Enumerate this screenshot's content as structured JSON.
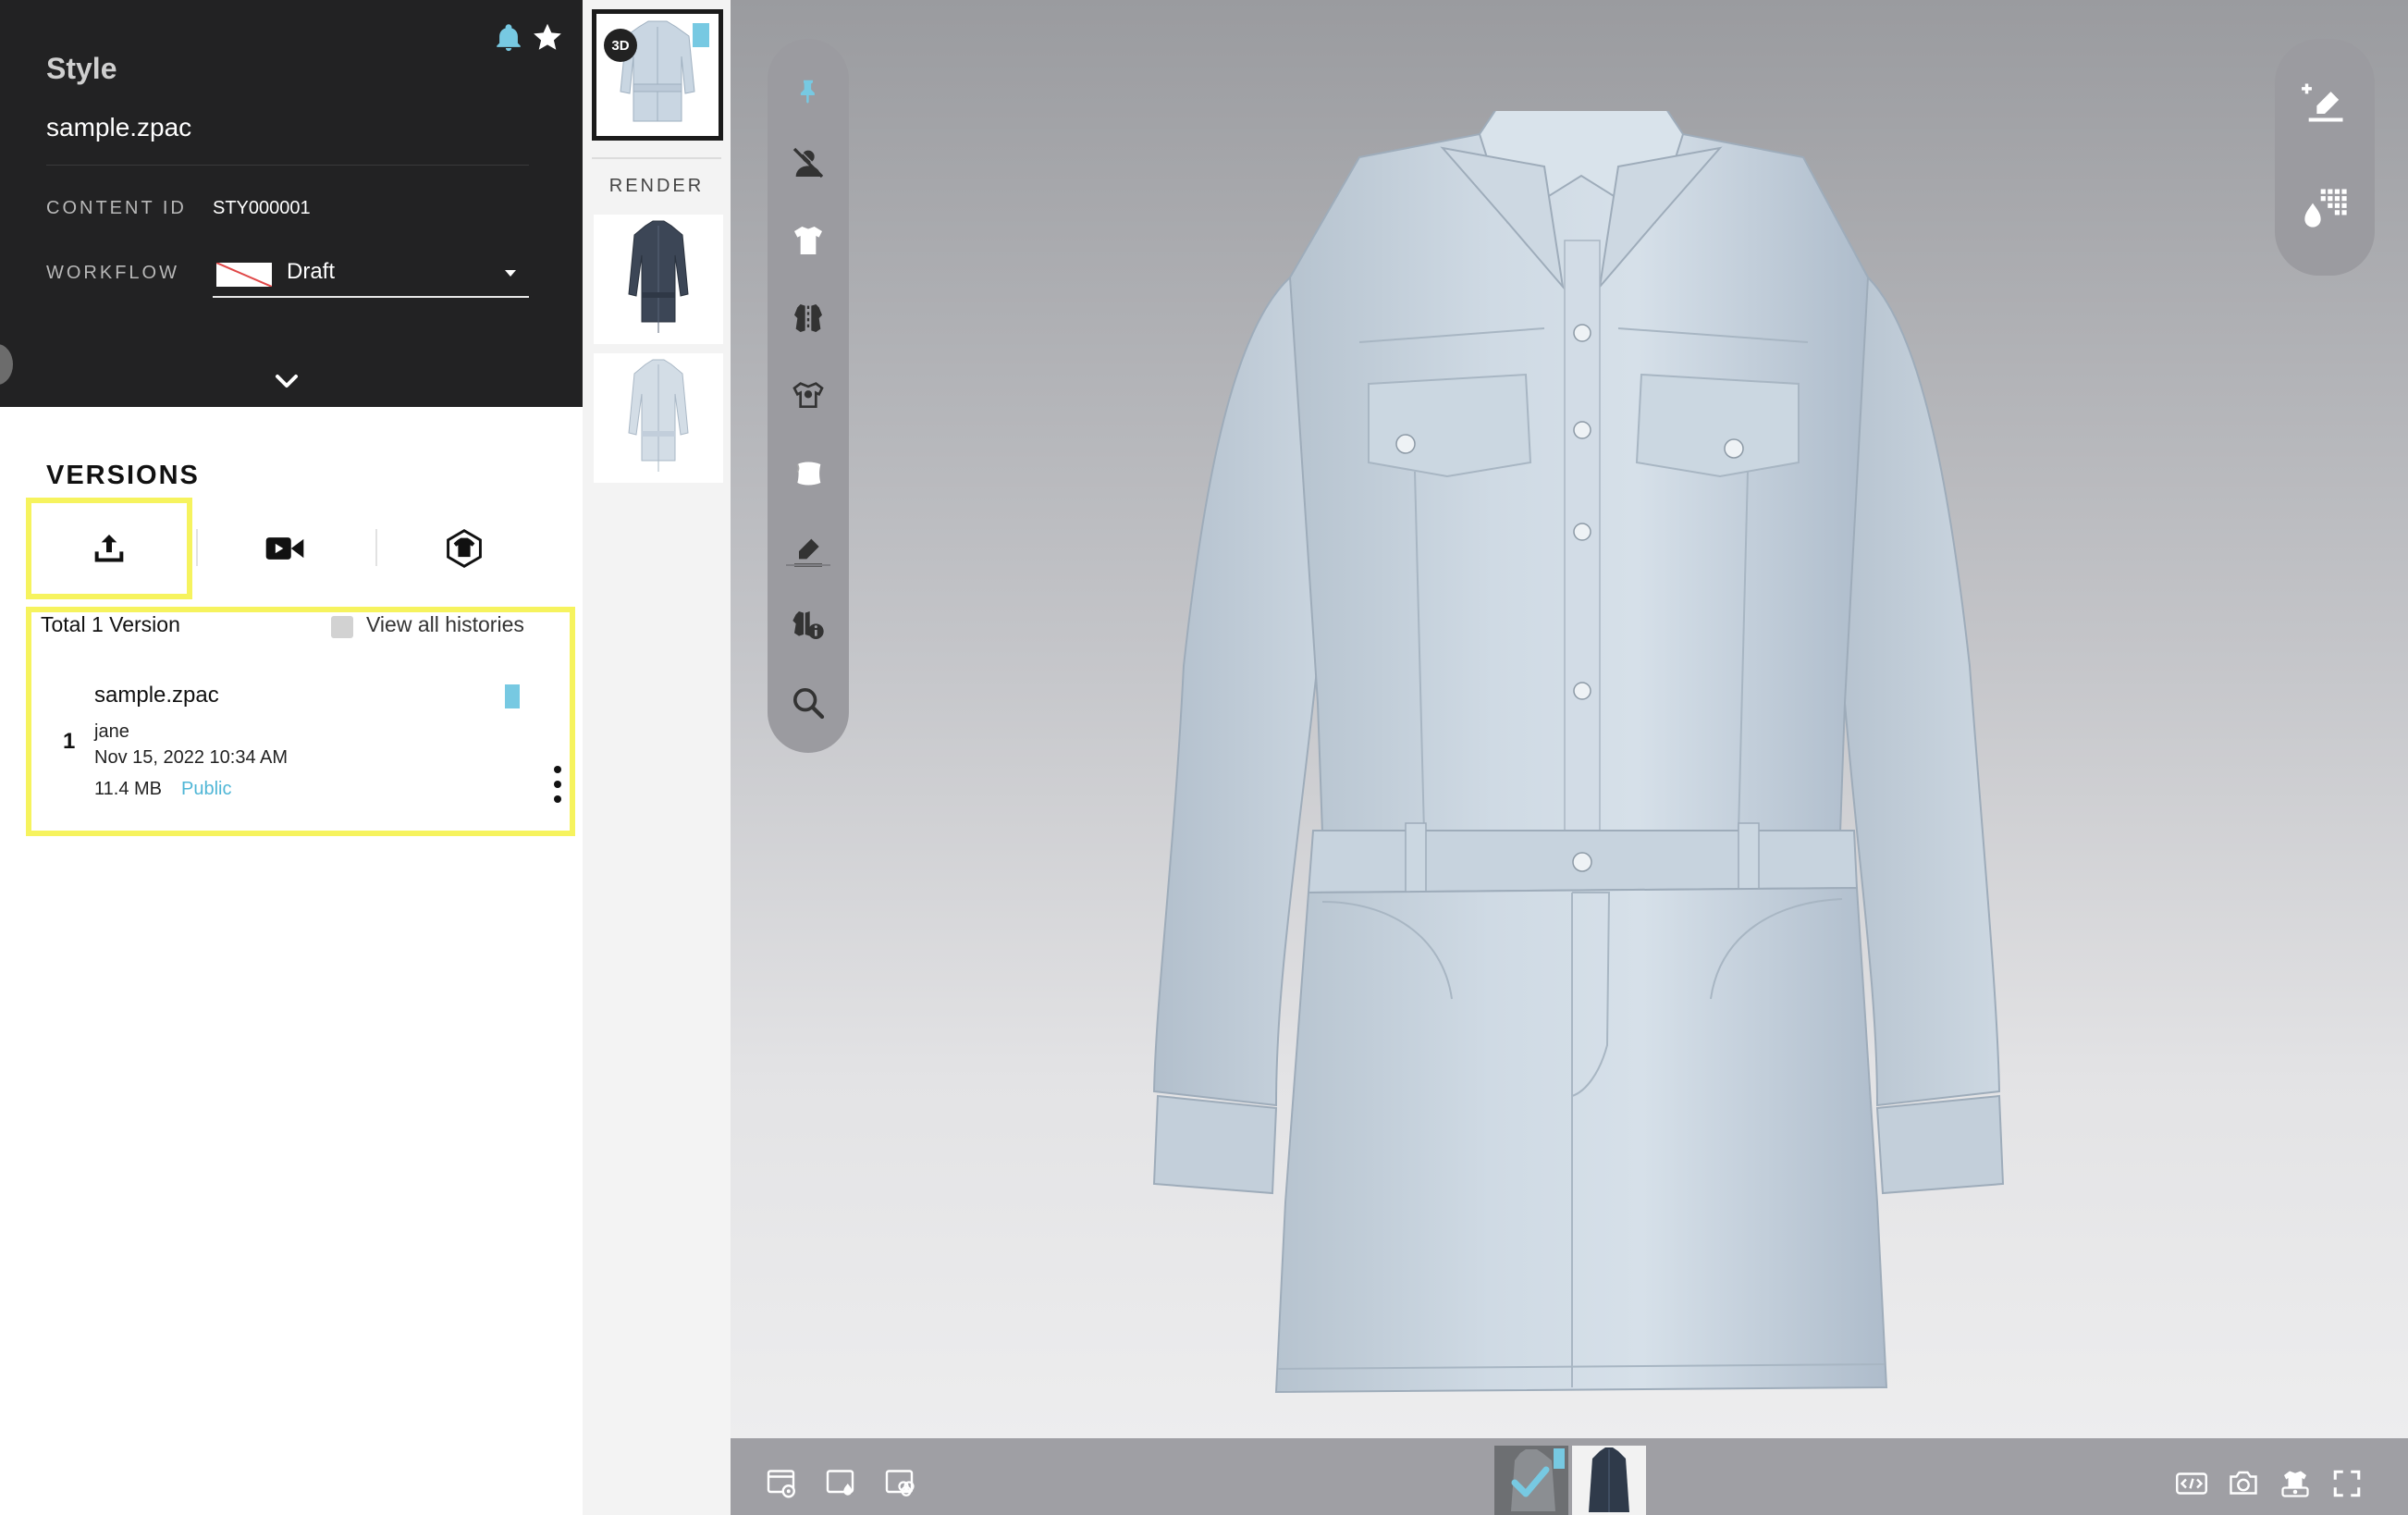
{
  "style_panel": {
    "heading": "Style",
    "filename": "sample.zpac",
    "content_id_label": "CONTENT ID",
    "content_id_value": "STY000001",
    "workflow_label": "WORKFLOW",
    "workflow_value": "Draft"
  },
  "versions": {
    "title": "VERSIONS",
    "tabs": [
      {
        "icon": "upload-icon"
      },
      {
        "icon": "video-icon"
      },
      {
        "icon": "3d-garment-icon"
      }
    ],
    "total_label": "Total 1 Version",
    "view_all_label": "View all histories",
    "view_all_checked": false,
    "items": [
      {
        "number": "1",
        "name": "sample.zpac",
        "user": "jane",
        "date": "Nov 15, 2022 10:34 AM",
        "size": "11.4 MB",
        "visibility": "Public"
      }
    ]
  },
  "thumbnails": {
    "badge": "3D",
    "render_label": "RENDER"
  },
  "toolbar_left": [
    "pin-icon",
    "avatar-hide-icon",
    "garment-icon",
    "fabric-icon",
    "trim-icon",
    "fabric-sheet-icon",
    "annotation-icon",
    "colorway-info-icon",
    "search-icon"
  ],
  "toolbar_right": [
    "add-annotation-icon",
    "color-palette-icon"
  ],
  "bottom_bar": {
    "left_icons": [
      "scene-settings-icon",
      "material-icon",
      "colorway-icon"
    ],
    "right_icons": [
      "embed-icon",
      "snapshot-icon",
      "turntable-icon",
      "fullscreen-icon"
    ]
  },
  "colors": {
    "accent": "#77c9e2",
    "highlight": "#f6f35e",
    "header_bg": "#222223"
  }
}
